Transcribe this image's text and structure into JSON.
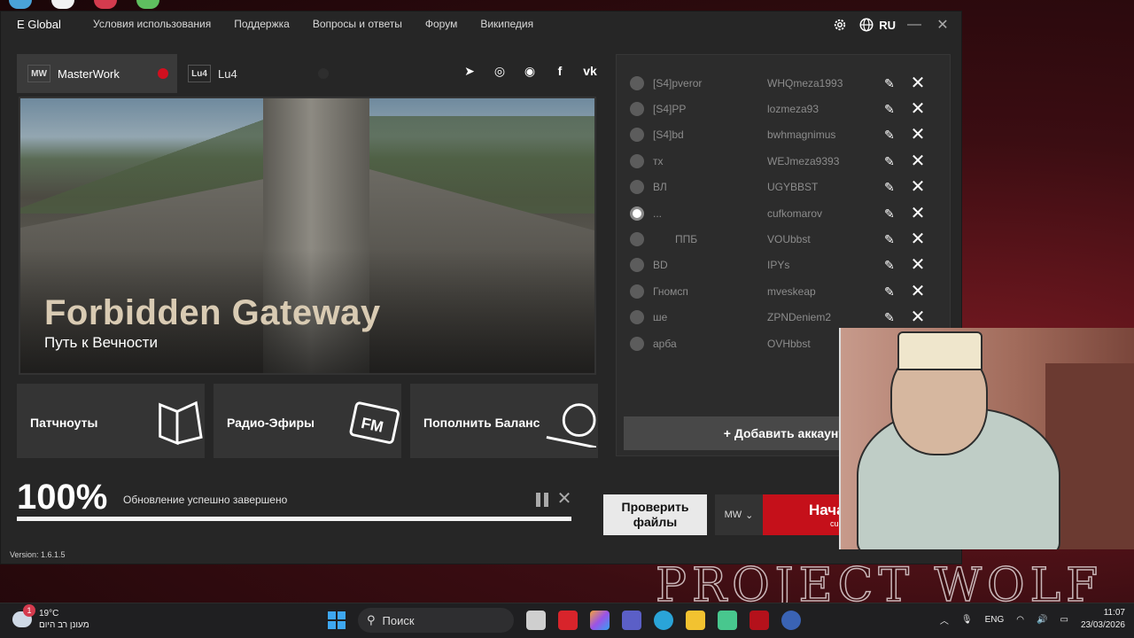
{
  "window": {
    "brand": "E Global",
    "nav": [
      "Условия использования",
      "Поддержка",
      "Вопросы и ответы",
      "Форум",
      "Википедия"
    ],
    "language": "RU",
    "minimize": "—",
    "close": "✕"
  },
  "tabs": [
    {
      "logo": "MW",
      "label": "MasterWork",
      "active": true
    },
    {
      "logo": "Lu4",
      "label": "Lu4",
      "active": false
    }
  ],
  "socials": {
    "telegram": "➤",
    "instagram": "◎",
    "discord": "◉",
    "facebook": "f",
    "vk": "vk"
  },
  "banner": {
    "title": "Forbidden Gateway",
    "subtitle": "Путь к Вечности"
  },
  "tiles": [
    {
      "label": "Патчноуты"
    },
    {
      "label": "Радио-Эфиры"
    },
    {
      "label": "Пополнить Баланс"
    }
  ],
  "accounts": [
    {
      "nick": "[S4]pveror",
      "login": "WHQmeza1993",
      "selected": false
    },
    {
      "nick": "[S4]PP",
      "login": "lozmeza93",
      "selected": false
    },
    {
      "nick": "[S4]bd",
      "login": "bwhmagnimus",
      "selected": false
    },
    {
      "nick": "тх",
      "login": "WEJmeza9393",
      "selected": false
    },
    {
      "nick": "ВЛ",
      "login": "UGYBBST",
      "selected": false
    },
    {
      "nick": "...",
      "login": "cufkomarov",
      "selected": true
    },
    {
      "nick": "ППБ",
      "login": "VOUbbst",
      "selected": false
    },
    {
      "nick": "BD",
      "login": "IPYs",
      "selected": false
    },
    {
      "nick": "Гномсп",
      "login": "mveskeap",
      "selected": false
    },
    {
      "nick": "ше",
      "login": "ZPNDeniem2",
      "selected": false
    },
    {
      "nick": "арба",
      "login": "OVHbbst",
      "selected": false
    }
  ],
  "add_account_label": "+ Добавить аккаунт",
  "progress": {
    "percent_label": "100%",
    "fraction": 1.0,
    "status": "Обновление успешно завершено"
  },
  "version": "Version: 1.6.1.5",
  "buttons": {
    "check_files": "Проверить файлы",
    "mw_select": "MW",
    "start_main": "Нача",
    "start_sub": "cu"
  },
  "wallpaper_text": "PROJECT WOLF",
  "taskbar": {
    "weather_temp": "19°C",
    "weather_desc": "מעונן רב היום",
    "weather_badge": "1",
    "search_placeholder": "Поиск",
    "lang": "ENG",
    "time": "11:07",
    "date": "23/03/2026"
  },
  "colors": {
    "accent_red": "#c5101a",
    "panel": "#262626"
  }
}
